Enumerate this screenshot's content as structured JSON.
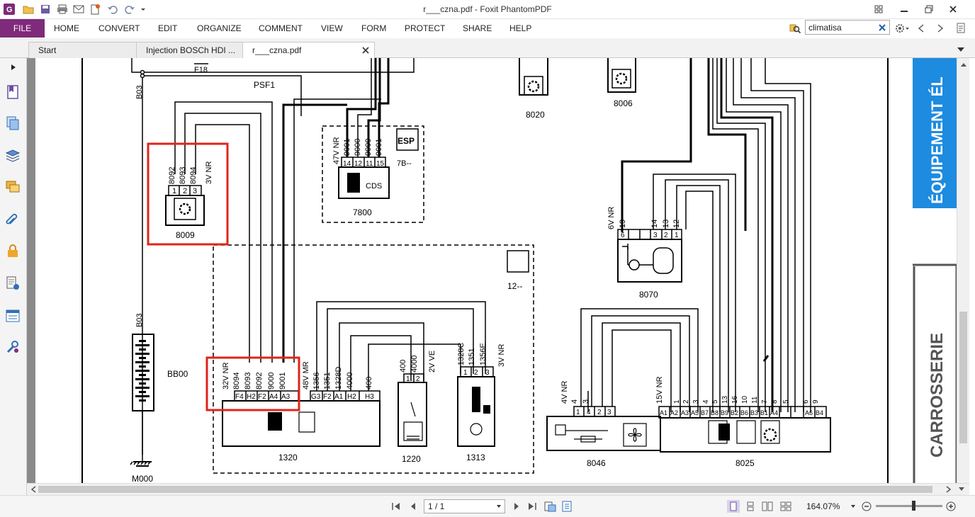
{
  "app": {
    "title": "r___czna.pdf - Foxit PhantomPDF"
  },
  "menu": {
    "file": "FILE",
    "items": [
      "HOME",
      "CONVERT",
      "EDIT",
      "ORGANIZE",
      "COMMENT",
      "VIEW",
      "FORM",
      "PROTECT",
      "SHARE",
      "HELP"
    ]
  },
  "search": {
    "value": "climatisa"
  },
  "tabs": [
    {
      "label": "Start",
      "active": false
    },
    {
      "label": "Injection BOSCh HDI ...",
      "active": false
    },
    {
      "label": "r___czna.pdf",
      "active": true
    }
  ],
  "status": {
    "page_field": "1 / 1",
    "zoom": "164.07%"
  },
  "doc": {
    "labels": {
      "f18": "F18",
      "psf1": "PSF1",
      "b03_top": "B03",
      "b03_bottom": "B03",
      "m000": "M000",
      "bb00": "BB00",
      "c8009": "8009",
      "c8009_wires": [
        "8092",
        "8093",
        "8094"
      ],
      "c8009_pins": [
        "1",
        "2",
        "3"
      ],
      "c8009_conn": "3V NR",
      "c7800": "7800",
      "c7800_conn": "47V NR",
      "c7800_wires": [
        "9001",
        "9000",
        "9000",
        "9001"
      ],
      "c7800_pins": [
        "14",
        "12",
        "11",
        "15"
      ],
      "c7800_cds": "CDS",
      "esp": "ESP",
      "esp_ref": "7B--",
      "c1320": "1320",
      "c1320_conn1": "32V NR",
      "c1320_wires1": [
        "8094",
        "8093",
        "8092",
        "9000",
        "9001"
      ],
      "c1320_pins1": [
        "F4",
        "H2",
        "F2",
        "A4",
        "A3"
      ],
      "c1320_conn2": "48V MR",
      "c1320_wires2": [
        "1356",
        "1351",
        "1328D",
        "4000",
        "400"
      ],
      "c1320_pins2": [
        "G3",
        "F2",
        "A1",
        "H2",
        "H3"
      ],
      "c1220": "1220",
      "c1220_conn": "2V VE",
      "c1220_wires": [
        "400",
        "4000"
      ],
      "c1220_pins": [
        "1",
        "2"
      ],
      "c1313": "1313",
      "c1313_conn": "3V NR",
      "c1313_wires": [
        "1328C",
        "1351",
        "1356E"
      ],
      "c1313_pins": [
        "1",
        "2",
        "3"
      ],
      "ref12": "12--",
      "c8020": "8020",
      "c8006": "8006",
      "c8070": "8070",
      "c8070_conn": "6V NR",
      "c8070_wires": [
        "19",
        "14",
        "13",
        "12"
      ],
      "c8070_pins": [
        "6",
        "",
        "",
        "3",
        "2",
        "1"
      ],
      "c8046": "8046",
      "c8046_conn": "4V NR",
      "c8046_wires": [
        "4",
        "3"
      ],
      "c8046_pins": [
        "1",
        "4",
        "2",
        "3"
      ],
      "c8025": "8025",
      "c8025_conn": "15V NR",
      "c8025_wires": [
        "1",
        "2",
        "3",
        "4",
        "5",
        "13",
        "16",
        "10",
        "11",
        "7",
        "8",
        "5",
        "6",
        "9"
      ],
      "c8025_pins": [
        "A1",
        "A2",
        "A3",
        "A5",
        "B7",
        "B8",
        "B9",
        "B2",
        "B6",
        "B3",
        "B1",
        "A4",
        "",
        "A6",
        "B4"
      ],
      "side_tab_top": "ÉQUIPEMENT ÉL",
      "side_tab_bottom": "CARROSSERIE"
    }
  }
}
